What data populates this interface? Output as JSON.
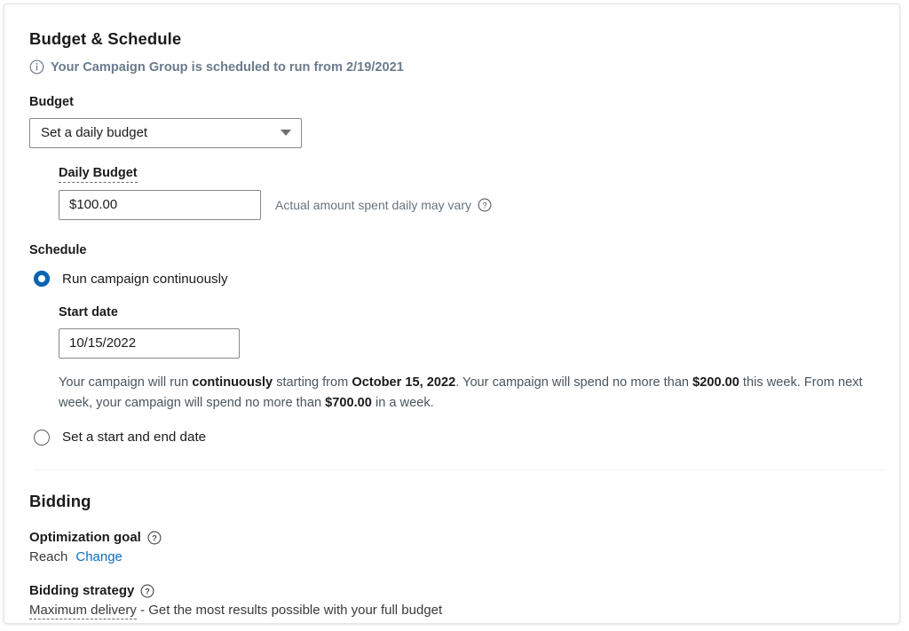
{
  "card": {
    "accent_color": "#0a65b5",
    "link_color": "#0f6cbd",
    "notice_color": "#6b7b8c"
  },
  "budget_schedule": {
    "title": "Budget & Schedule",
    "notice": {
      "icon": "info-circle-icon",
      "text": "Your Campaign Group is scheduled to run from 2/19/2021"
    },
    "budget": {
      "label": "Budget",
      "select": {
        "value": "Set a daily budget",
        "icon": "chevron-down-icon"
      },
      "daily_budget": {
        "label": "Daily Budget",
        "value": "$100.00",
        "placeholder": "$0.00",
        "hint": "Actual amount spent daily may vary",
        "hint_icon": "help-circle-icon"
      }
    },
    "schedule": {
      "label": "Schedule",
      "options": [
        {
          "label": "Run campaign continuously",
          "selected": true
        },
        {
          "label": "Set a start and end date",
          "selected": false
        }
      ],
      "start_date": {
        "label": "Start date",
        "value": "10/15/2022",
        "placeholder": "mm/dd/yyyy"
      },
      "summary": {
        "part1": "Your campaign will run ",
        "bold1": "continuously",
        "part2": " starting from ",
        "bold2": "October 15, 2022",
        "part3": ". Your campaign will spend no more than ",
        "bold3": "$200.00",
        "part4": " this week. From next week, your campaign will spend no more than ",
        "bold4": "$700.00",
        "part5": " in a week."
      }
    }
  },
  "bidding": {
    "title": "Bidding",
    "optimization_goal": {
      "label": "Optimization goal",
      "help_icon": "help-circle-icon",
      "value": "Reach",
      "change_label": "Change"
    },
    "bidding_strategy": {
      "label": "Bidding strategy",
      "help_icon": "help-circle-icon",
      "name": "Maximum delivery",
      "description": " - Get the most results possible with your full budget"
    }
  }
}
